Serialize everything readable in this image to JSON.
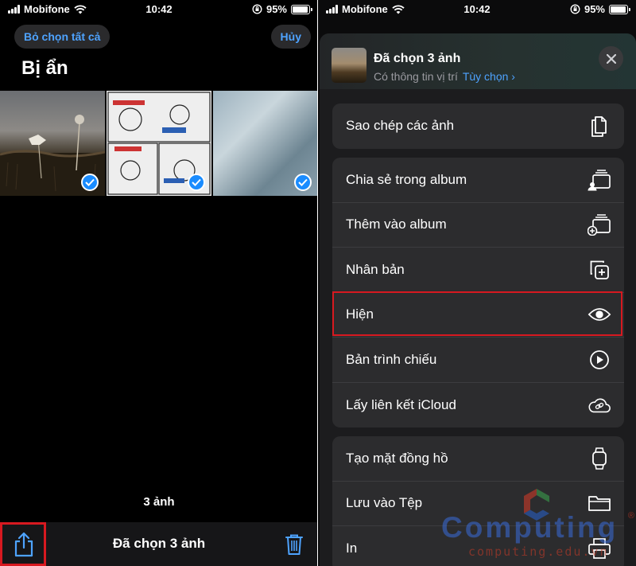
{
  "status": {
    "carrier": "Mobifone",
    "time": "10:42",
    "battery": "95%",
    "battery_level": 0.95
  },
  "left": {
    "deselect_all": "Bỏ chọn tất cả",
    "cancel": "Hủy",
    "album_title": "Bị ẩn",
    "photo_count": "3 ảnh",
    "toolbar_title": "Đã chọn 3 ảnh"
  },
  "sheet": {
    "title": "Đã chọn 3 ảnh",
    "subtitle": "Có thông tin vị trí",
    "options_link": "Tùy chọn",
    "groups": [
      {
        "rows": [
          {
            "label": "Sao chép các ảnh",
            "icon": "copy-icon"
          }
        ]
      },
      {
        "rows": [
          {
            "label": "Chia sẻ trong album",
            "icon": "shared-album-icon"
          },
          {
            "label": "Thêm vào album",
            "icon": "add-album-icon"
          },
          {
            "label": "Nhân bản",
            "icon": "duplicate-icon"
          },
          {
            "label": "Hiện",
            "icon": "eye-icon"
          },
          {
            "label": "Bản trình chiếu",
            "icon": "play-icon"
          },
          {
            "label": "Lấy liên kết iCloud",
            "icon": "cloud-link-icon"
          }
        ]
      },
      {
        "rows": [
          {
            "label": "Tạo mặt đồng hồ",
            "icon": "watch-icon"
          },
          {
            "label": "Lưu vào Tệp",
            "icon": "folder-icon"
          },
          {
            "label": "In",
            "icon": "printer-icon"
          }
        ]
      }
    ]
  },
  "watermark": {
    "brand": "Computing",
    "url": "computing.edu.vn",
    "reg": "®"
  },
  "colors": {
    "accent": "#4ea3ff",
    "check": "#1a8cff",
    "highlight": "#d71920"
  }
}
